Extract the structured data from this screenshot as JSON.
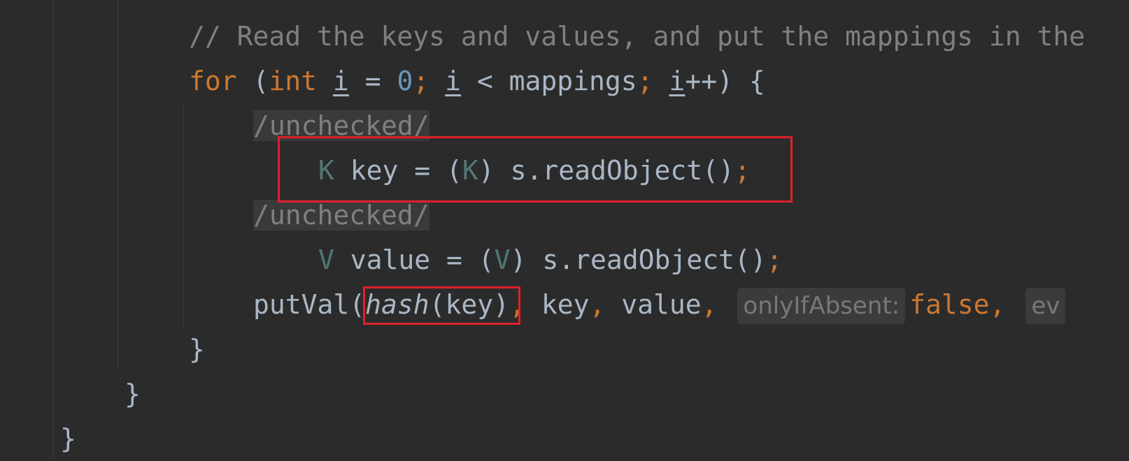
{
  "editor": {
    "comment": "// Read the keys and values, and put the mappings in the",
    "for_line": {
      "kw_for": "for",
      "open": " (",
      "kw_int": "int",
      "var": "i",
      "eq": " = ",
      "zero": "0",
      "semi": ";",
      "lt": " < mappings",
      "inc": "++) {"
    },
    "suppress": "/unchecked/",
    "key_line": {
      "type": "K",
      "rest1": " key = (",
      "type2": "K",
      "rest2": ") s.readObject()",
      "semi": ";"
    },
    "value_line": {
      "type": "V",
      "rest1": " value = (",
      "type2": "V",
      "rest2": ") s.readObject()",
      "semi": ";"
    },
    "putval_line": {
      "call": "putVal(",
      "hash": "hash",
      "args": "(key)",
      "comma": ",",
      "key": " key",
      "value": " value",
      "hint1": "onlyIfAbsent:",
      "false": "false",
      "hint2": "ev"
    },
    "close_brace": "}"
  },
  "colors": {
    "background": "#2b2b2b",
    "keyword": "#cc7832",
    "number": "#6897bb",
    "comment": "#808080",
    "highlight_box": "#e0202a"
  }
}
